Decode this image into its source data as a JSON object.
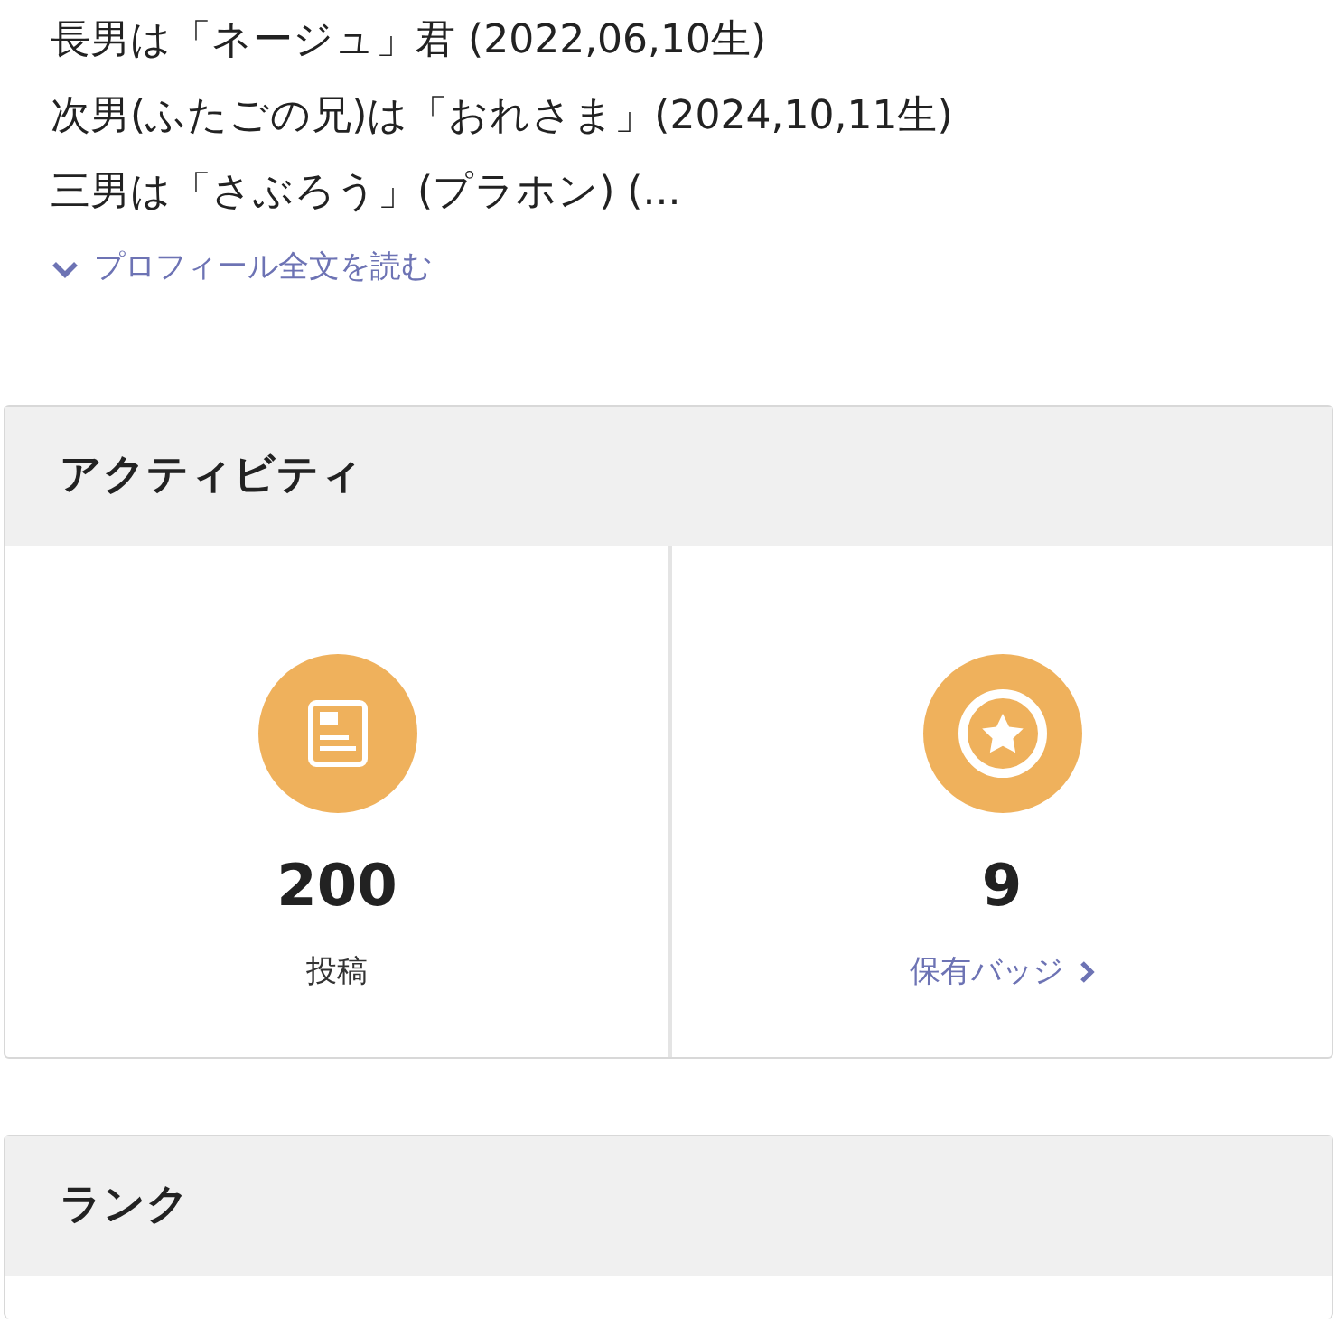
{
  "profile": {
    "lines": [
      "長男は「ネージュ」君 (2022,06,10生)",
      "次男(ふたごの兄)は「おれさま」(2024,10,11生)",
      "三男は「さぶろう」(プラホン) (..."
    ],
    "read_more": "プロフィール全文を読む"
  },
  "activity": {
    "title": "アクティビティ",
    "stats": [
      {
        "kind": "posts",
        "value": "200",
        "label": "投稿"
      },
      {
        "kind": "badges",
        "value": "9",
        "label": "保有バッジ"
      }
    ]
  },
  "rank": {
    "title": "ランク"
  }
}
